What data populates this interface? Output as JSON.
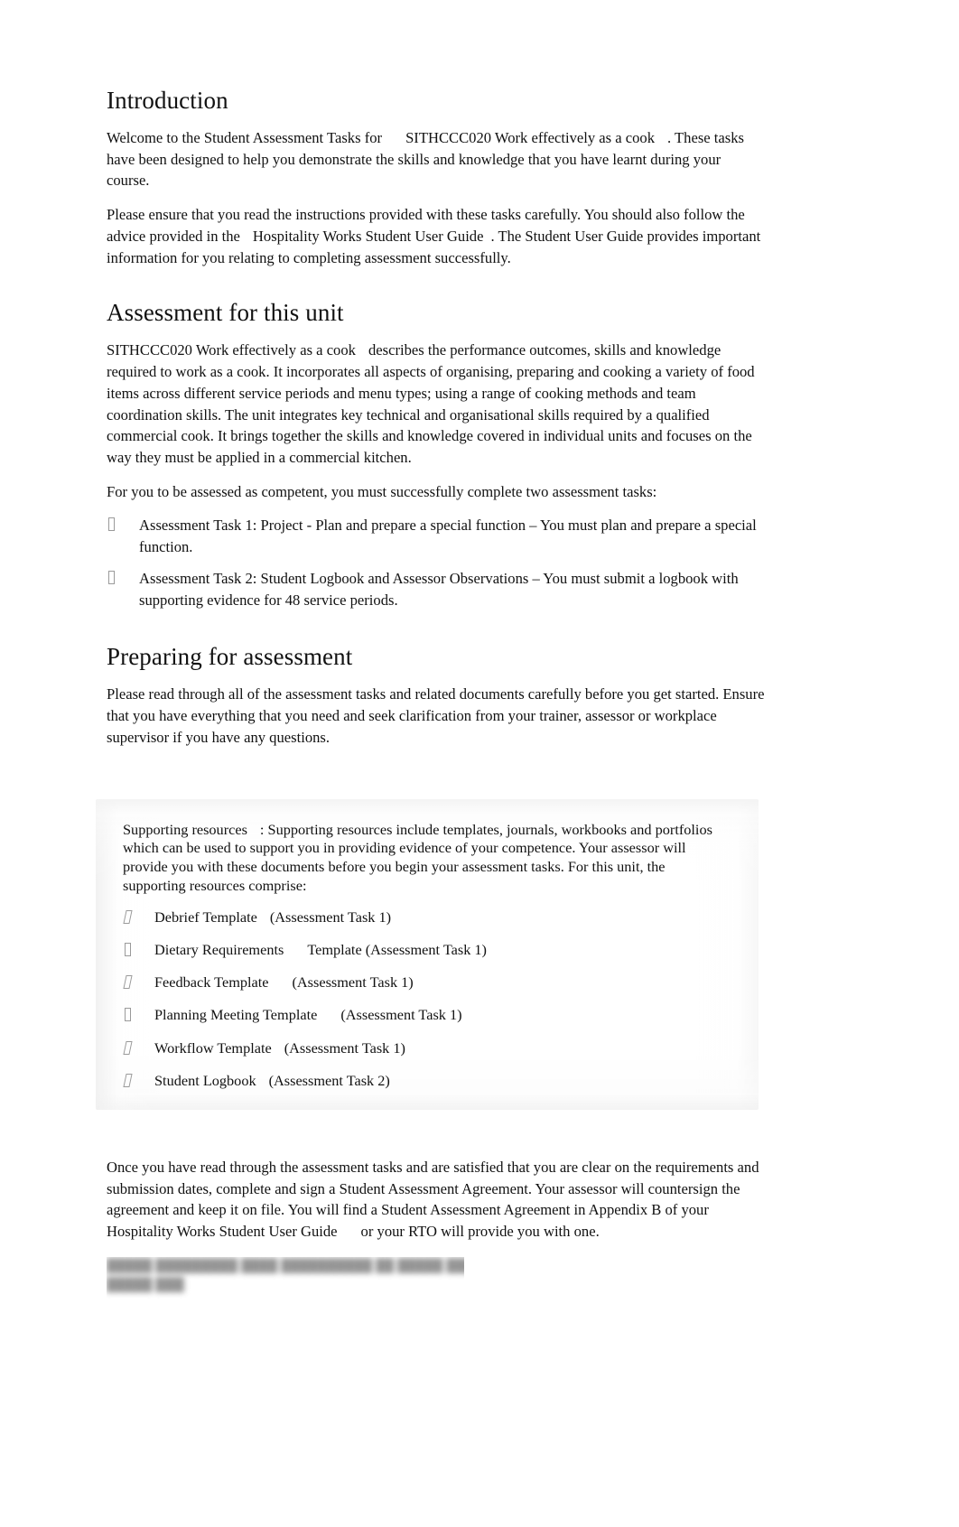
{
  "document": {
    "sections": [
      {
        "heading": "Introduction",
        "paragraphs": [
          {
            "parts": [
              "Welcome to the Student Assessment Tasks for",
              "SITHCCC020 Work effectively as a cook",
              ". These tasks have been designed to help you demonstrate the skills and knowledge that you have learnt during your course."
            ]
          },
          {
            "parts": [
              "Please ensure that you read the instructions provided with these tasks carefully. You should also follow the advice provided in the",
              "Hospitality Works Student User Guide",
              ". The Student User Guide provides important information for you relating to completing assessment successfully."
            ]
          }
        ]
      },
      {
        "heading": "Assessment for this unit",
        "paragraphs": [
          {
            "parts": [
              "SITHCCC020 Work effectively as a cook",
              "describes the performance outcomes, skills and knowledge required to work as a cook. It incorporates all aspects of organising, preparing and cooking a variety of food items across different service periods and menu types; using a range of cooking methods and team coordination skills. The unit integrates key technical and organisational skills required by a qualified commercial cook. It brings together the skills and knowledge covered in individual units and focuses on the way they must be applied in a commercial kitchen."
            ]
          },
          {
            "parts": [
              "For you to be assessed as competent, you must successfully complete two assessment tasks:"
            ]
          }
        ],
        "bullets": [
          "Assessment Task 1: Project - Plan and prepare a special function – You must plan and prepare a special function.",
          "Assessment Task 2: Student Logbook and Assessor Observations – You must submit a logbook with supporting evidence for 48 service periods."
        ]
      },
      {
        "heading": "Preparing for assessment",
        "paragraphs": [
          {
            "parts": [
              "Please read through all of the assessment tasks and related documents carefully before you get started. Ensure that you have everything that you need and seek clarification from your trainer, assessor or workplace supervisor if you have any questions."
            ]
          }
        ]
      }
    ],
    "resource_box": {
      "label": "Supporting resources",
      "intro": ": Supporting resources include templates, journals, workbooks and portfolios which can be used to support you in providing evidence of your competence. Your assessor will provide you with these documents before you begin your assessment tasks. For this unit, the supporting resources comprise:",
      "items": [
        {
          "name": "Debrief Template",
          "task": "(Assessment Task 1)"
        },
        {
          "name": "Dietary Requirements",
          "task": "Template (Assessment Task 1)"
        },
        {
          "name": "Feedback Template",
          "task": "(Assessment Task 1)"
        },
        {
          "name": "Planning Meeting Template",
          "task": "(Assessment Task 1)"
        },
        {
          "name": "Workflow Template",
          "task": "(Assessment Task 1)"
        },
        {
          "name": "Student Logbook",
          "task": "(Assessment Task 2)"
        }
      ]
    },
    "closing": {
      "part1": "Once you have read through the assessment tasks and are satisfied that you are clear on the requirements and submission dates, complete and sign a Student Assessment Agreement. Your assessor will countersign the agreement and keep it on file. You will find a Student Assessment Agreement in Appendix B of your",
      "part2": "Hospitality Works Student User Guide",
      "part3": "or your RTO will provide you with one."
    },
    "footer_obscured": {
      "line1": "█████ █████████ ████ ██████████ ██ █████ ████ ████",
      "line2": "█████ ████"
    }
  }
}
